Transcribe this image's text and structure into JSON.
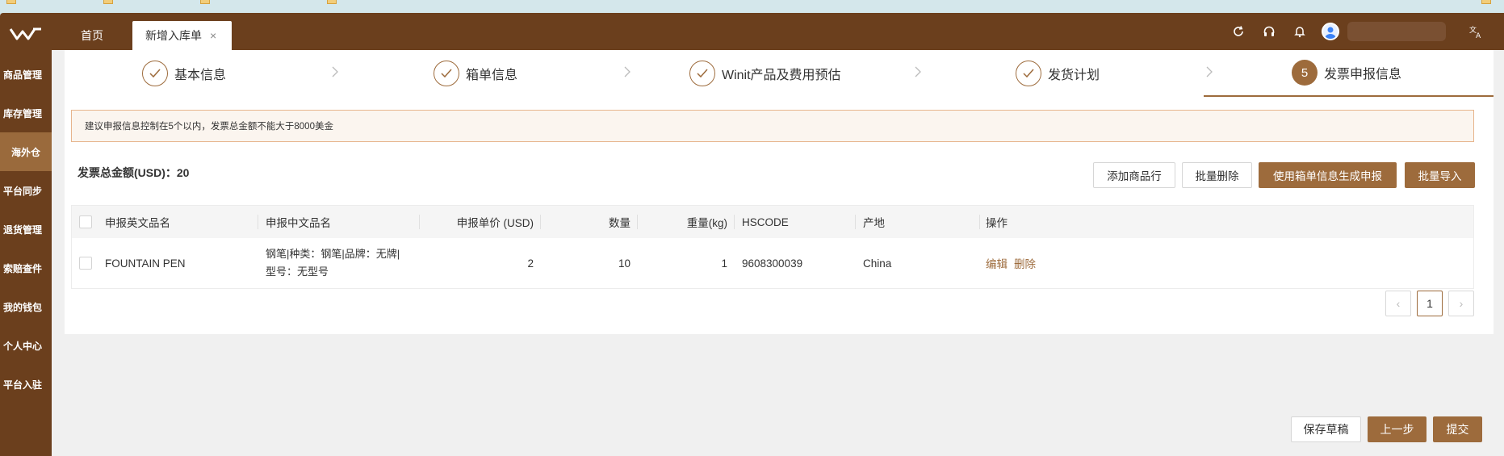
{
  "sidebar": {
    "logo_icon": "winit-logo-icon",
    "items": [
      {
        "label": "商品管理"
      },
      {
        "label": "库存管理"
      },
      {
        "label": "海外仓"
      },
      {
        "label": "平台同步"
      },
      {
        "label": "退货管理"
      },
      {
        "label": "索赔查件"
      },
      {
        "label": "我的钱包"
      },
      {
        "label": "个人中心"
      },
      {
        "label": "平台入驻"
      }
    ]
  },
  "tabs": {
    "home": "首页",
    "current": "新增入库单",
    "close_glyph": "×"
  },
  "topbar_icons": [
    "refresh-icon",
    "headset-icon",
    "bell-icon",
    "avatar-icon",
    "translate-icon"
  ],
  "steps": [
    {
      "label": "基本信息",
      "status": "done"
    },
    {
      "label": "箱单信息",
      "status": "done"
    },
    {
      "label": "Winit产品及费用预估",
      "status": "done"
    },
    {
      "label": "发货计划",
      "status": "done"
    },
    {
      "label": "发票申报信息",
      "status": "current",
      "number": "5"
    }
  ],
  "notice": "建议申报信息控制在5个以内，发票总金额不能大于8000美金",
  "total": "发票总金额(USD)：20",
  "buttons": {
    "add_row": "添加商品行",
    "batch_delete": "批量删除",
    "generate": "使用箱单信息生成申报",
    "batch_import": "批量导入"
  },
  "table": {
    "columns": [
      "申报英文品名",
      "申报中文品名",
      "申报单价 (USD)",
      "数量",
      "重量(kg)",
      "HSCODE",
      "产地",
      "操作"
    ],
    "rows": [
      {
        "en_name": "FOUNTAIN PEN",
        "cn_name_line1": "钢笔|种类：钢笔|品牌：无牌|",
        "cn_name_line2": "型号：无型号",
        "unit_price": "2",
        "quantity": "10",
        "weight": "1",
        "hscode": "9608300039",
        "origin": "China",
        "action_edit": "编辑",
        "action_delete": "删除"
      }
    ]
  },
  "pagination": {
    "prev": "‹",
    "current_page": "1",
    "next": "›"
  },
  "footer": {
    "save_draft": "保存草稿",
    "prev_step": "上一步",
    "submit": "提交"
  },
  "colors": {
    "brand_dark": "#6b3f1d",
    "brand_accent": "#9d6b3c"
  }
}
